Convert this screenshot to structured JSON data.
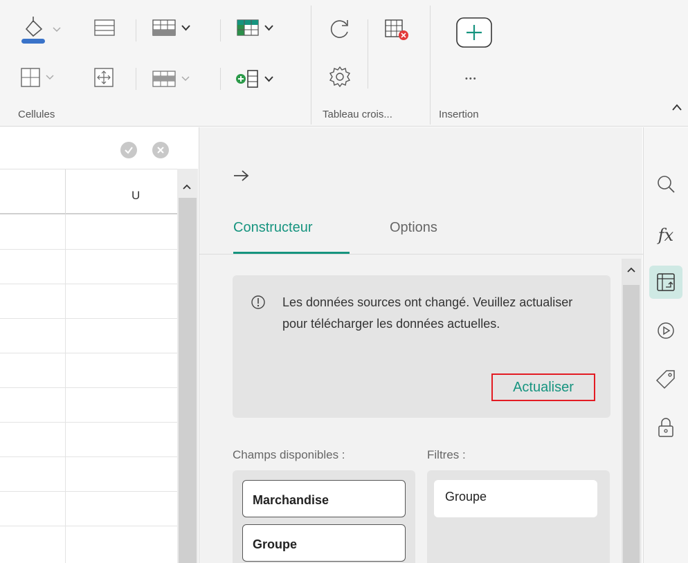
{
  "ribbon": {
    "groups": {
      "cells": "Cellules",
      "pivot": "Tableau crois...",
      "insert": "Insertion"
    },
    "insert_more": "•••"
  },
  "sheet": {
    "column_letter": "U"
  },
  "panel": {
    "tabs": {
      "constructor": "Constructeur",
      "options": "Options"
    },
    "notice": {
      "text": "Les données sources ont changé. Veuillez actualiser pour télécharger les données actuelles.",
      "refresh_label": "Actualiser"
    },
    "fields_label": "Champs disponibles :",
    "filters_label": "Filtres :",
    "fields": [
      "Marchandise",
      "Groupe"
    ],
    "filters": [
      "Groupe"
    ]
  },
  "colors": {
    "accent": "#16947f",
    "highlight_border": "#e31b23",
    "rail_active": "#cfe9e4"
  },
  "icons": {
    "rail": [
      "search-icon",
      "function-icon",
      "pivot-table-icon",
      "play-icon",
      "tag-icon",
      "lock-icon"
    ]
  }
}
